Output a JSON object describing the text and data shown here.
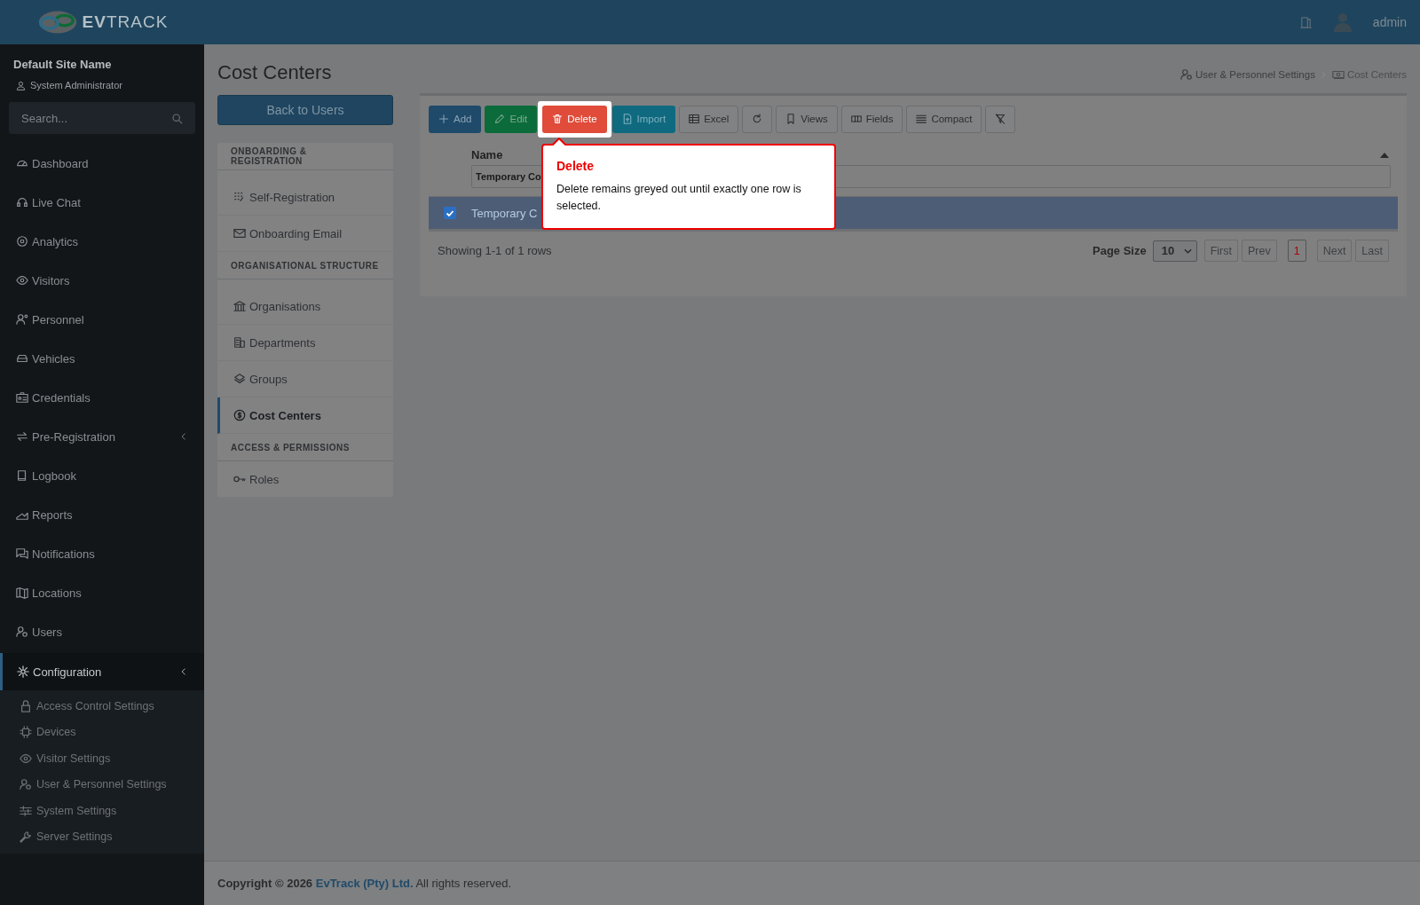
{
  "header": {
    "logo": "**EV**TRACK",
    "user": "admin"
  },
  "sidebar": {
    "site_name": "Default Site Name",
    "role": "System Administrator",
    "search": {
      "placeholder": "Search..."
    },
    "items": [
      {
        "label": "Dashboard",
        "selected": false,
        "collapsible": false
      },
      {
        "label": "Live Chat",
        "selected": false,
        "collapsible": false
      },
      {
        "label": "Analytics",
        "selected": false,
        "collapsible": false
      },
      {
        "label": "Visitors",
        "selected": false,
        "collapsible": false
      },
      {
        "label": "Personnel",
        "selected": false,
        "collapsible": false
      },
      {
        "label": "Vehicles",
        "selected": false,
        "collapsible": false
      },
      {
        "label": "Credentials",
        "selected": false,
        "collapsible": false
      },
      {
        "label": "Pre-Registration",
        "selected": false,
        "collapsible": true
      },
      {
        "label": "Logbook",
        "selected": false,
        "collapsible": false
      },
      {
        "label": "Reports",
        "selected": false,
        "collapsible": false
      },
      {
        "label": "Notifications",
        "selected": false,
        "collapsible": false
      },
      {
        "label": "Locations",
        "selected": false,
        "collapsible": false
      },
      {
        "label": "Users",
        "selected": false,
        "collapsible": false
      },
      {
        "label": "Configuration",
        "selected": true,
        "collapsible": true,
        "children": [
          {
            "label": "Access Control Settings"
          },
          {
            "label": "Devices"
          },
          {
            "label": "Visitor Settings"
          },
          {
            "label": "User & Personnel Settings"
          },
          {
            "label": "System Settings"
          },
          {
            "label": "Server Settings"
          }
        ]
      }
    ]
  },
  "page": {
    "title": "Cost Centers",
    "breadcrumb": [
      "User & Personnel Settings",
      "Cost Centers"
    ]
  },
  "back_button": "Back to Users",
  "subnav": [
    {
      "heading": "ONBOARDING & REGISTRATION",
      "items": [
        {
          "label": "Self-Registration",
          "selected": false
        },
        {
          "label": "Onboarding Email",
          "selected": false
        }
      ]
    },
    {
      "heading": "ORGANISATIONAL STRUCTURE",
      "items": [
        {
          "label": "Organisations",
          "selected": false
        },
        {
          "label": "Departments",
          "selected": false
        },
        {
          "label": "Groups",
          "selected": false
        },
        {
          "label": "Cost Centers",
          "selected": true
        }
      ]
    },
    {
      "heading": "ACCESS & PERMISSIONS",
      "items": [
        {
          "label": "Roles",
          "selected": false
        }
      ]
    }
  ],
  "toolbar": [
    {
      "label": "Add",
      "kind": "primary",
      "highlighted": false
    },
    {
      "label": "Edit",
      "kind": "success",
      "highlighted": false
    },
    {
      "label": "Delete",
      "kind": "danger",
      "highlighted": true
    },
    {
      "label": "Import",
      "kind": "info",
      "highlighted": false
    },
    {
      "label": "Excel",
      "kind": "default",
      "highlighted": false
    },
    {
      "kind": "default",
      "highlighted": false
    },
    {
      "label": "Views",
      "kind": "default",
      "highlighted": false
    },
    {
      "label": "Fields",
      "kind": "default",
      "highlighted": false
    },
    {
      "label": "Compact",
      "kind": "default",
      "highlighted": false
    },
    {
      "kind": "default",
      "highlighted": false
    }
  ],
  "table": {
    "columns": [
      {
        "label": "Name",
        "filter": "Temporary Co"
      }
    ],
    "rows": [
      {
        "selected": true,
        "cells": [
          "Temporary C"
        ]
      }
    ]
  },
  "pager": {
    "summary": "Showing 1-1 of 1 rows",
    "page_size_label": "Page Size",
    "page_size": "10",
    "buttons": [
      {
        "label": "First",
        "disabled": true,
        "selected": false
      },
      {
        "label": "Prev",
        "disabled": true,
        "selected": false
      },
      {
        "label": "1",
        "disabled": false,
        "selected": true
      },
      {
        "label": "Next",
        "disabled": true,
        "selected": false
      },
      {
        "label": "Last",
        "disabled": true,
        "selected": false
      }
    ]
  },
  "tour": {
    "title": "Delete",
    "text": "Delete remains greyed out until exactly one row is selected."
  },
  "footer": {
    "bold": "Copyright © 2026",
    "link": "EvTrack (Pty) Ltd.",
    "rest": "All rights reserved."
  }
}
